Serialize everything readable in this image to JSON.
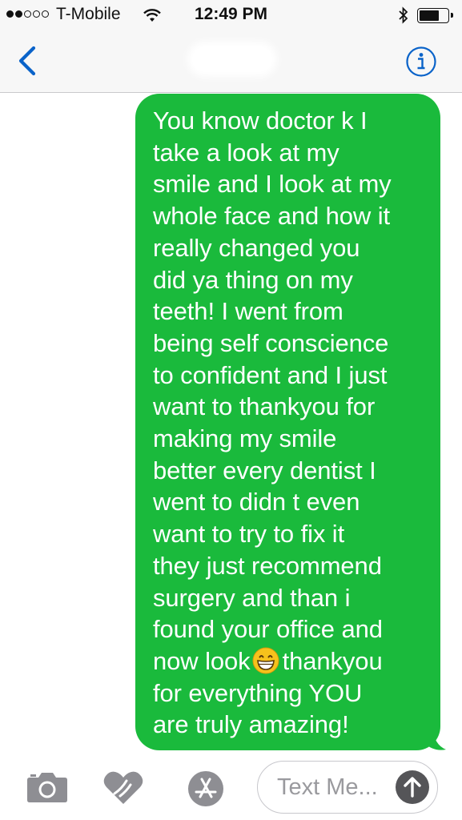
{
  "status_bar": {
    "carrier": "T-Mobile",
    "time": "12:49 PM",
    "signal_bars_filled": 2,
    "signal_bars_total": 5,
    "battery_level": 0.72
  },
  "nav_bar": {
    "back_icon": "chevron-left-icon",
    "info_icon": "info-icon",
    "accent_color": "#0a63c9"
  },
  "message": {
    "bubble_color": "#1aba3c",
    "text_color": "#ffffff",
    "lines": [
      "You know doctor k I",
      "take a look at my",
      "smile and I look at my",
      "whole face and how it",
      "really changed you",
      "did ya thing on my",
      "teeth! I went from",
      "being self conscience",
      "to confident and I just",
      "want to thankyou for",
      "making my smile",
      "better every dentist I",
      "went to didn t even",
      "want to try to fix it",
      "they just recommend",
      "surgery and than i",
      "found your office and"
    ],
    "line_18_before": "now look",
    "line_18_emoji": "grinning-face-emoji",
    "line_18_after": "thankyou",
    "line_19": "for everything YOU",
    "line_20": "are truly amazing!"
  },
  "input_bar": {
    "placeholder": "Text Me...",
    "camera_icon": "camera-icon",
    "digital_touch_icon": "digital-touch-icon",
    "app_store_icon": "app-store-icon",
    "send_icon": "send-arrow-icon"
  }
}
